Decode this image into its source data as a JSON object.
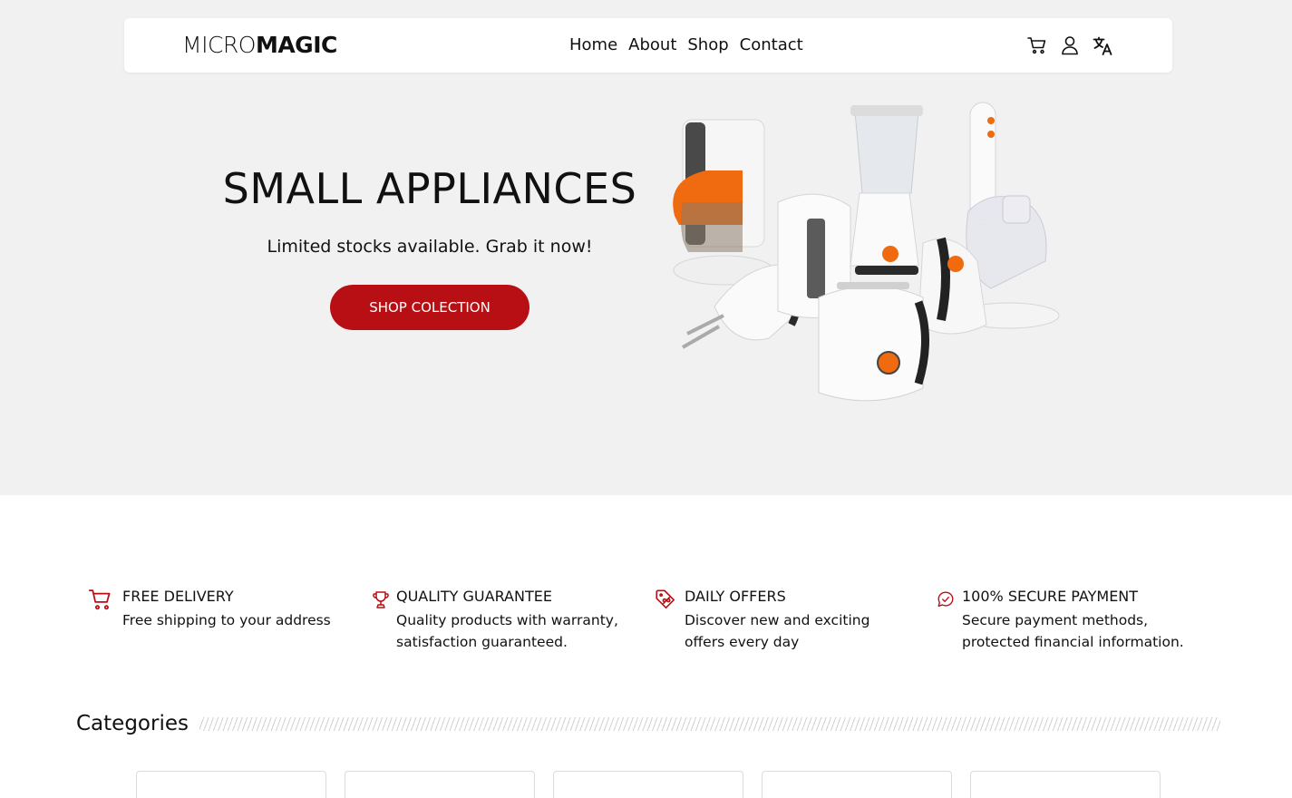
{
  "brand": {
    "part1": "MICRO",
    "part2": "MAGIC"
  },
  "nav": {
    "links": [
      "Home",
      "About",
      "Shop",
      "Contact"
    ]
  },
  "nav_icons": [
    "cart-icon",
    "user-icon",
    "translate-icon"
  ],
  "hero": {
    "title": "SMALL APPLIANCES",
    "subtitle": "Limited stocks available. Grab it now!",
    "button": "SHOP COLECTION"
  },
  "features": [
    {
      "icon": "cart-icon",
      "title": "FREE DELIVERY",
      "desc": "Free shipping to your address"
    },
    {
      "icon": "trophy-icon",
      "title": "QUALITY GUARANTEE",
      "desc": "Quality products with warranty, satisfaction guaranteed."
    },
    {
      "icon": "discount-tag-icon",
      "title": "DAILY OFFERS",
      "desc": "Discover new and exciting offers every day"
    },
    {
      "icon": "secure-check-icon",
      "title": "100% SECURE PAYMENT",
      "desc": "Secure payment methods, protected financial information."
    }
  ],
  "categories": {
    "heading": "Categories",
    "card_count": 5
  },
  "colors": {
    "accent": "#b80f14",
    "hero_bg": "#f1f1f1",
    "appliance_orange": "#f06a0f"
  }
}
